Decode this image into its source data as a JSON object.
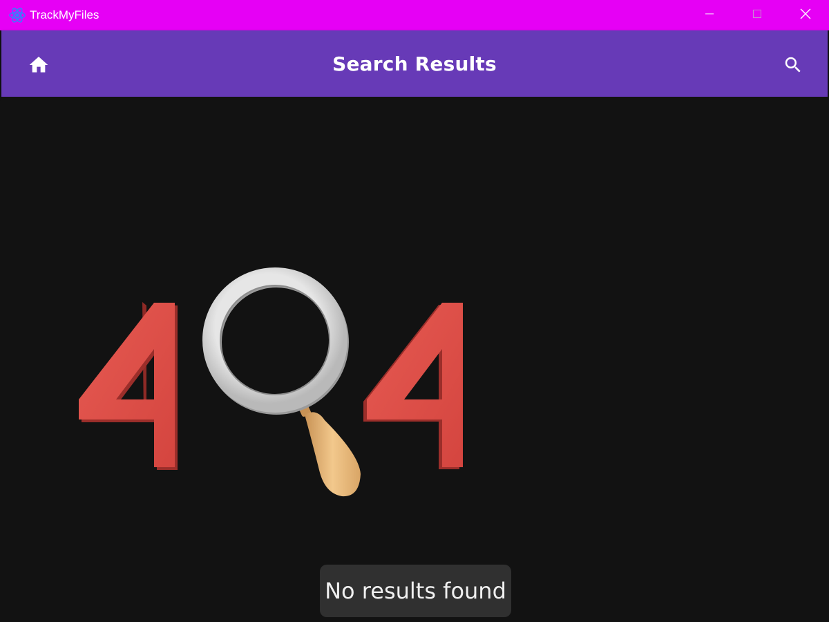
{
  "window": {
    "title": "TrackMyFiles",
    "app_icon": "atom-icon",
    "controls": [
      "minimize-icon",
      "maximize-icon",
      "close-icon"
    ],
    "titlebar_color": "#e600f5"
  },
  "appbar": {
    "title": "Search Results",
    "leading_icon": "home-icon",
    "trailing_icon": "search-icon",
    "color": "#673ab7"
  },
  "content": {
    "background": "#121212",
    "illustration": "404-magnifier-illustration",
    "illustration_text": "404"
  },
  "snackbar": {
    "message": "No results found"
  }
}
